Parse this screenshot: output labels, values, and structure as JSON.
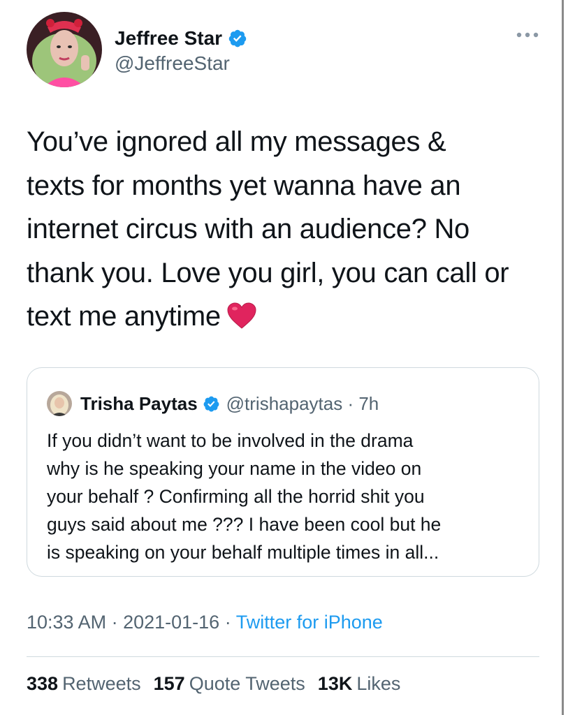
{
  "author": {
    "name": "Jeffree Star",
    "handle": "@JeffreeStar",
    "verified": true
  },
  "tweet": {
    "text": "You’ve ignored all my messages &\ntexts for months yet wanna have an\ninternet circus with an audience? No\nthank you. Love you girl, you can call or\ntext me anytime",
    "emoji": "red-heart"
  },
  "quoted_tweet": {
    "name": "Trisha Paytas",
    "handle": "@trishapaytas · 7h",
    "verified": true,
    "text": "If you didn’t want to be involved in the drama\nwhy is he speaking your name in the video on\nyour behalf ? Confirming all the horrid shit you\nguys said about me ??? I have been cool but he\nis speaking on your behalf multiple times in all..."
  },
  "meta": {
    "time": "10:33 AM",
    "separator": " · ",
    "date": "2021-01-16",
    "source": "Twitter for iPhone"
  },
  "stats": {
    "retweets": {
      "count": "338",
      "label": "Retweets"
    },
    "quote_tweets": {
      "count": "157",
      "label": "Quote Tweets"
    },
    "likes": {
      "count": "13K",
      "label": "Likes"
    }
  },
  "colors": {
    "accent": "#1d9bf0",
    "secondary_text": "#536471",
    "border": "#cfd9de",
    "heart": "#e0245e"
  },
  "icons": [
    "verified-badge-icon",
    "more-options-icon",
    "red-heart-emoji"
  ]
}
